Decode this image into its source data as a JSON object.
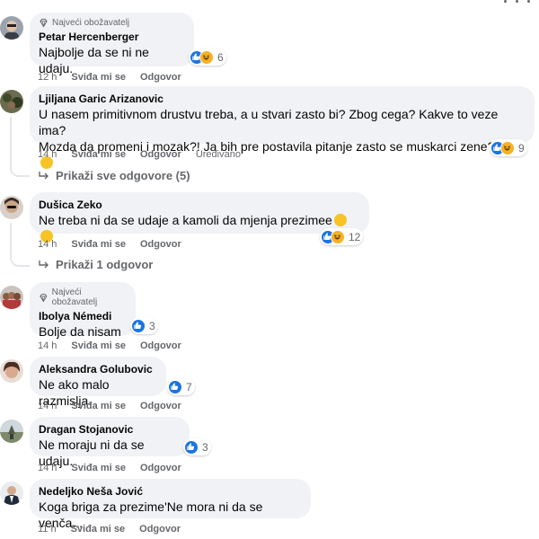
{
  "comments": [
    {
      "badge": "Najveći obožavatelj",
      "author": "Petar Hercenberger",
      "text": "Najbolje da se ni ne udaju.",
      "reaction_count": "6",
      "time": "12 h",
      "like_label": "Sviđa mi se",
      "reply_label": "Odgovor"
    },
    {
      "author": "Ljiljana Garic Arizanovic",
      "text_line1": "U nasem primitivnom drustvu treba, a u stvari zasto bi? Zbog cega? Kakve to veze ima?",
      "text_line2": "Mozda da promeni i mozak?! Ja bih pre postavila pitanje zasto se muskarci zene?!",
      "reaction_count": "9",
      "time": "14 h",
      "like_label": "Sviđa mi se",
      "reply_label": "Odgovor",
      "edited_label": "Uređivano",
      "replies_link": "Prikaži sve odgovore (5)"
    },
    {
      "author": "Dušica Zeko",
      "text": "Ne treba ni da se udaje a kamoli da mjenja prezimee",
      "reaction_count": "12",
      "time": "14 h",
      "like_label": "Sviđa mi se",
      "reply_label": "Odgovor",
      "replies_link": "Prikaži 1 odgovor"
    },
    {
      "badge": "Najveći obožavatelj",
      "author": "Ibolya Némedi",
      "text": "Bolje da nisam",
      "reaction_count": "3",
      "time": "14 h",
      "like_label": "Sviđa mi se",
      "reply_label": "Odgovor"
    },
    {
      "author": "Aleksandra Golubovic",
      "text": "Ne ako malo razmislja.",
      "reaction_count": "7",
      "time": "14 h",
      "like_label": "Sviđa mi se",
      "reply_label": "Odgovor"
    },
    {
      "author": "Dragan Stojanovic",
      "text": "Ne moraju ni da se udaju.",
      "reaction_count": "3",
      "time": "14 h",
      "like_label": "Sviđa mi se",
      "reply_label": "Odgovor"
    },
    {
      "author": "Nedeljko Neša Jović",
      "text": "Koga briga za prezime'Ne mora ni da se venča...",
      "time": "11 h",
      "like_label": "Sviđa mi se",
      "reply_label": "Odgovor"
    }
  ],
  "colors": {
    "bubble": "#f0f2f5",
    "like_blue": "#1b74e4",
    "haha_yellow": "#f7b125",
    "meta_gray": "#65676b"
  }
}
